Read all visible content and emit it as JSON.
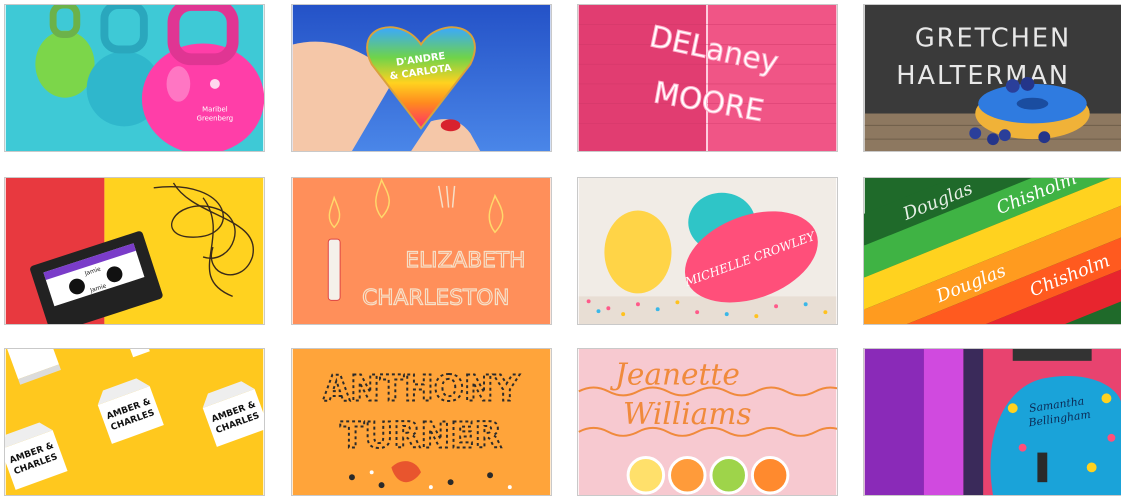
{
  "tiles": [
    {
      "id": "kettlebells",
      "text": [
        "Maribel",
        "Greenberg"
      ],
      "colors": {
        "bg": "#3ec9d6",
        "main": "#ff3ea8",
        "accent": "#7cd64a"
      }
    },
    {
      "id": "heart",
      "text": [
        "D'ANDRE",
        "& CARLOTA"
      ],
      "colors": {
        "bg": "#2a5fd1",
        "heart": "#ffb000"
      }
    },
    {
      "id": "neon-wall",
      "text": [
        "DELaney",
        "MOORE"
      ],
      "colors": {
        "bg": "#e8437a"
      }
    },
    {
      "id": "chalkboard",
      "text": [
        "GRETCHEN",
        "HALTERMAN"
      ],
      "colors": {
        "bg": "#3a3a3a",
        "donut": "#2f7be0"
      }
    },
    {
      "id": "cassette",
      "text": [
        "Jamie",
        "Jamie"
      ],
      "colors": {
        "left": "#e8393f",
        "right": "#ffd21f"
      }
    },
    {
      "id": "matches",
      "text": [
        "ELIZABETH",
        "CHARLESTON"
      ],
      "colors": {
        "bg": "#ff8f5a"
      }
    },
    {
      "id": "balloons",
      "text": [
        "MICHELLE CROWLEY"
      ],
      "colors": {
        "bg": "#f1ece6",
        "balloon": "#ff4f7a"
      }
    },
    {
      "id": "pencils",
      "text": [
        "Douglas",
        "Chisholm",
        "Douglas",
        "Chisholm"
      ],
      "colors": {}
    },
    {
      "id": "milk-cartons",
      "text": [
        "AMBER &",
        "CHARLES",
        "AMBER &",
        "CHARLES",
        "AMBER &",
        "CHARLES"
      ],
      "colors": {
        "bg": "#ffc81e"
      }
    },
    {
      "id": "leaves",
      "text": [
        "ANTHONY",
        "TURNER"
      ],
      "colors": {
        "bg": "#ffa43a"
      }
    },
    {
      "id": "citrus",
      "text": [
        "Jeanette",
        "Williams"
      ],
      "colors": {
        "bg": "#f7c9d0",
        "line": "#f08a3c"
      }
    },
    {
      "id": "guitar",
      "text": [
        "Samantha",
        "Bellingham"
      ],
      "colors": {
        "bg": "#e8436f",
        "guitar": "#1aa3d9"
      }
    }
  ]
}
